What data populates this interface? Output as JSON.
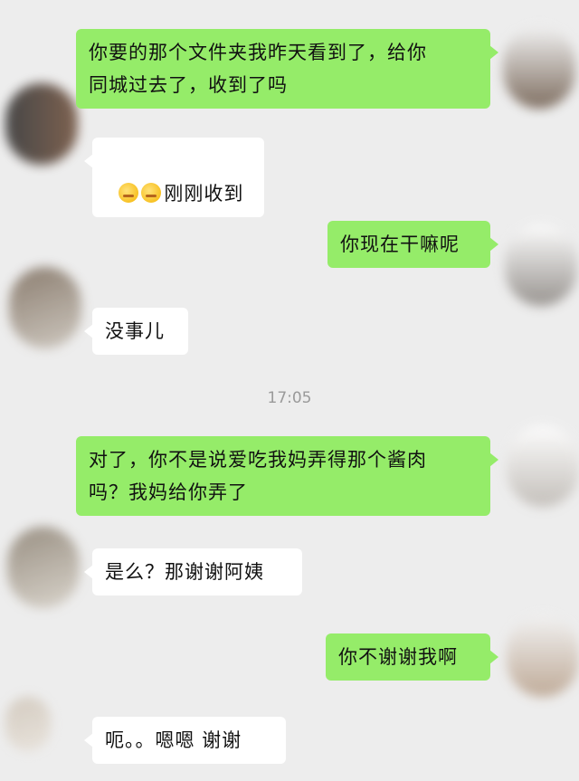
{
  "messages": [
    {
      "id": "m1",
      "side": "out",
      "text": "你要的那个文件夹我昨天看到了，给你\n同城过去了，收到了吗"
    },
    {
      "id": "m2",
      "side": "in",
      "emoji": [
        "smirk-emoji",
        "smirk-emoji"
      ],
      "text": "刚刚收到"
    },
    {
      "id": "m3",
      "side": "out",
      "text": "你现在干嘛呢"
    },
    {
      "id": "m4",
      "side": "in",
      "text": "没事儿"
    },
    {
      "id": "m5",
      "side": "out",
      "text": "对了，你不是说爱吃我妈弄得那个酱肉\n吗？我妈给你弄了"
    },
    {
      "id": "m6",
      "side": "in",
      "text": "是么？那谢谢阿姨"
    },
    {
      "id": "m7",
      "side": "out",
      "text": "你不谢谢我啊"
    },
    {
      "id": "m8",
      "side": "in",
      "text": "呃。。嗯嗯 谢谢"
    }
  ],
  "timestamp": "17:05",
  "colors": {
    "background": "#ededed",
    "outgoing": "#95ec69",
    "incoming": "#ffffff"
  }
}
